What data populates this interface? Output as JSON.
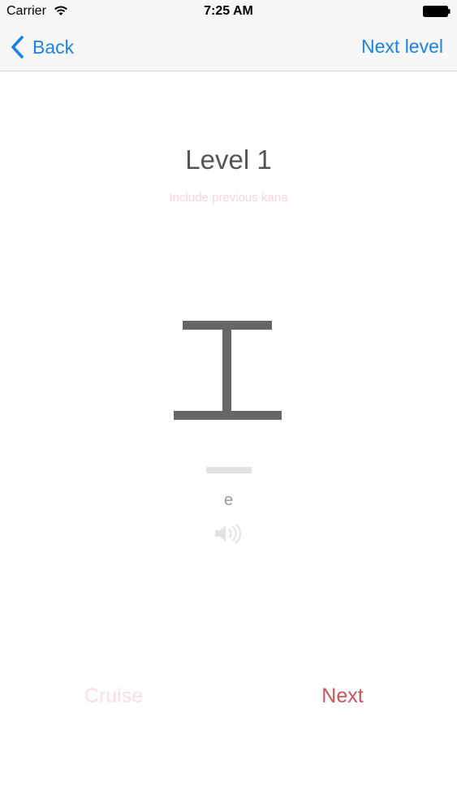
{
  "status_bar": {
    "carrier": "Carrier",
    "time": "7:25 AM",
    "wifi_icon": "wifi-icon",
    "battery_icon": "battery-full-icon"
  },
  "nav": {
    "back_label": "Back",
    "back_icon": "chevron-left-icon",
    "next_level_label": "Next level",
    "tint_color": "#1a82e2"
  },
  "main": {
    "level_title": "Level 1",
    "include_previous_label": "Include previous kana",
    "kana": "エ",
    "romaji": "e",
    "speaker_icon": "speaker-icon"
  },
  "footer": {
    "cruise_label": "Cruise",
    "next_label": "Next",
    "cruise_color": "#fbdde2",
    "next_color": "#c5555f"
  }
}
